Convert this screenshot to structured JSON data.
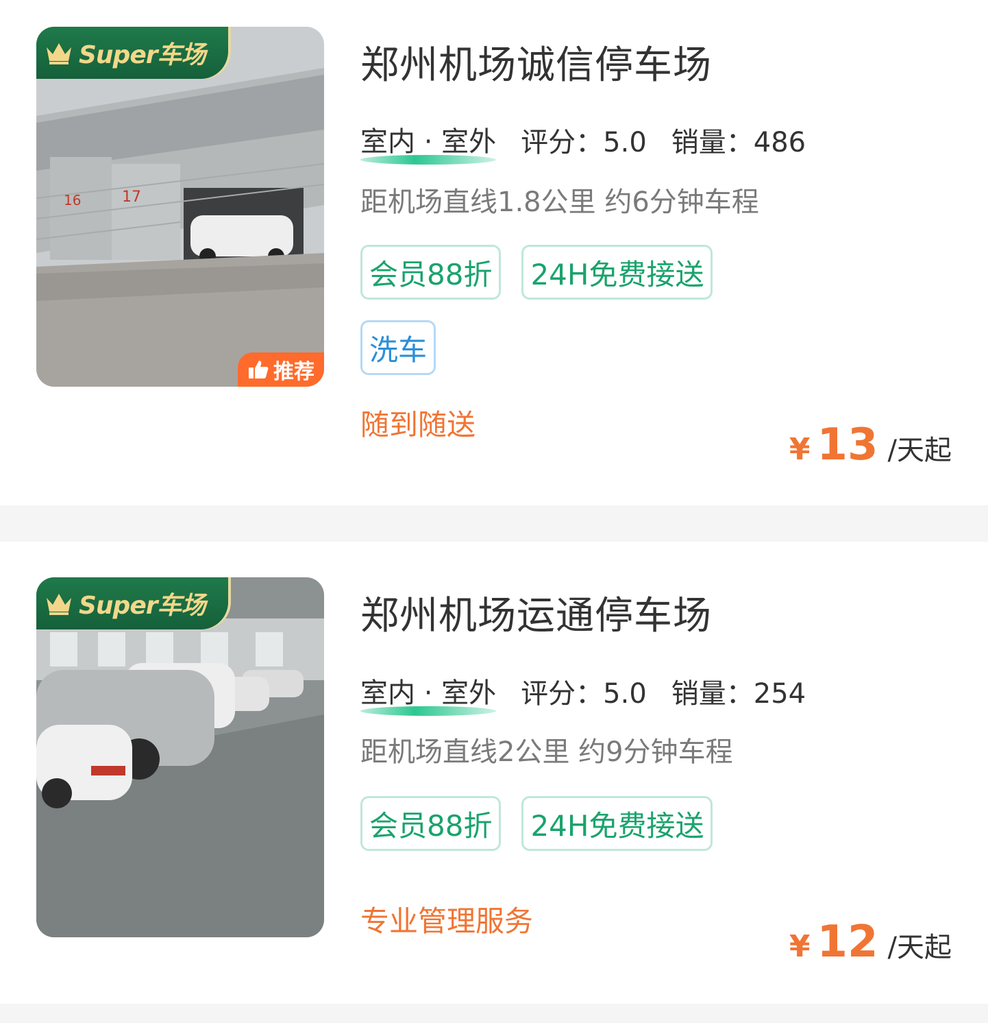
{
  "badges": {
    "super": "Super车场",
    "recommend": "推荐"
  },
  "lots": [
    {
      "title": "郑州机场诚信停车场",
      "location_type": "室内 · 室外",
      "rating_label": "评分：5.0",
      "sales_label": "销量：486",
      "distance": "距机场直线1.8公里 约6分钟车程",
      "tags_green": [
        "会员88折",
        "24H免费接送"
      ],
      "tags_blue": [
        "洗车"
      ],
      "slogan": "随到随送",
      "currency": "¥",
      "price": "13",
      "price_unit": "/天起",
      "recommended": true
    },
    {
      "title": "郑州机场运通停车场",
      "location_type": "室内 · 室外",
      "rating_label": "评分：5.0",
      "sales_label": "销量：254",
      "distance": "距机场直线2公里 约9分钟车程",
      "tags_green": [
        "会员88折",
        "24H免费接送"
      ],
      "tags_blue": [],
      "slogan": "专业管理服务",
      "currency": "¥",
      "price": "12",
      "price_unit": "/天起",
      "recommended": false
    }
  ],
  "colors": {
    "accent_orange": "#f07534",
    "tag_green": "#1aa36d",
    "tag_blue": "#2a8fd8",
    "badge_green": "#1f7a4a"
  }
}
